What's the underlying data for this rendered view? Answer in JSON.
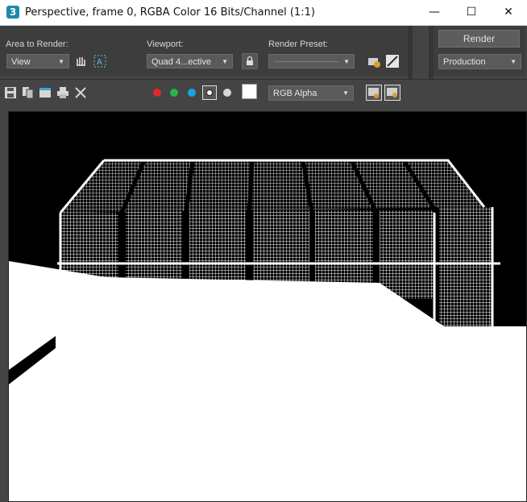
{
  "window": {
    "title": "Perspective, frame 0, RGBA Color 16 Bits/Channel (1:1)",
    "app_icon_glyph": "3",
    "minimize_glyph": "—",
    "maximize_glyph": "☐",
    "close_glyph": "✕"
  },
  "toolbar": {
    "area_to_render_label": "Area to Render:",
    "area_to_render_value": "View",
    "viewport_label": "Viewport:",
    "viewport_value": "Quad 4...ective",
    "render_preset_label": "Render Preset:",
    "render_preset_value": "",
    "render_button": "Render",
    "production_value": "Production"
  },
  "toolbar2": {
    "channel_value": "RGB Alpha",
    "channel_colors": {
      "red": "#e8262a",
      "green": "#27b44a",
      "blue": "#1aa3e6",
      "mono": "#d8d8d8"
    }
  },
  "icons": [
    "save-icon",
    "copy-icon",
    "clone-window-icon",
    "print-icon",
    "clear-icon",
    "region-icon",
    "auto-region-icon",
    "lock-icon",
    "preset-settings-icon",
    "environment-icon",
    "display-alpha-icon",
    "swatch-icon",
    "frame-window-icon",
    "toggle-ui-icon"
  ],
  "colors": {
    "background": "#444444",
    "frame_bg": "#000000",
    "render_white": "#ffffff"
  }
}
